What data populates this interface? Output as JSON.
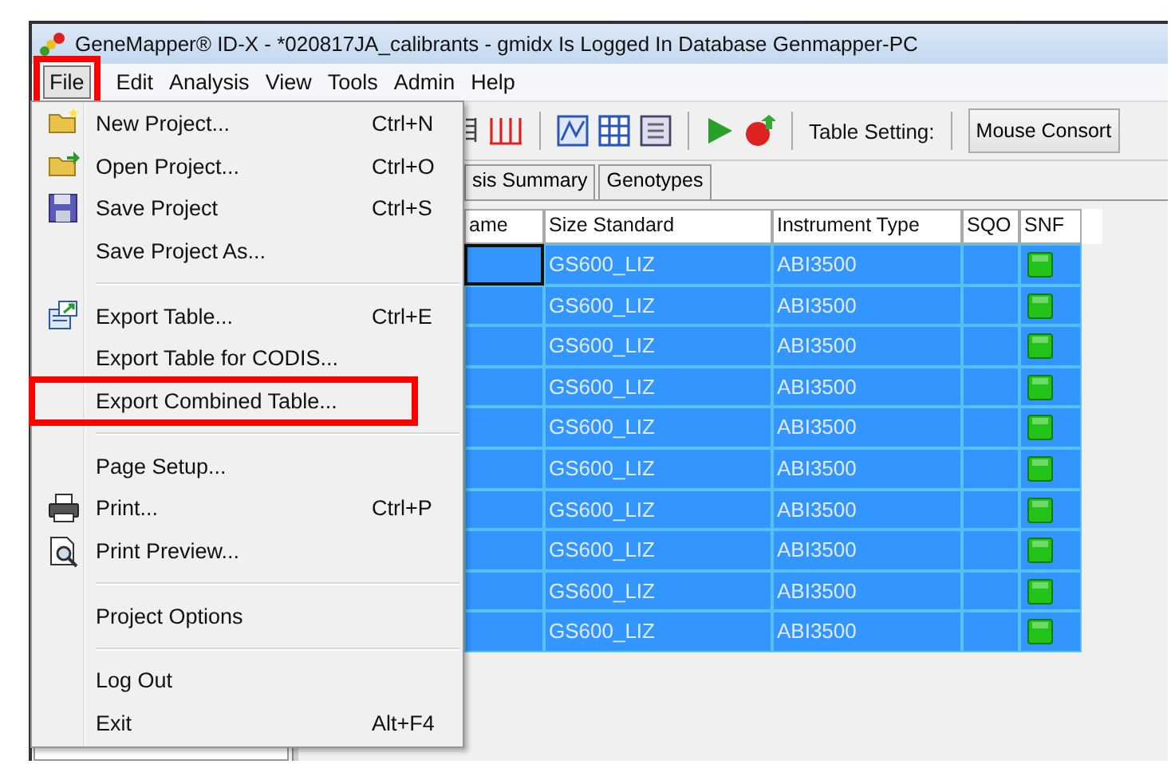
{
  "window": {
    "title": "GeneMapper® ID-X - *020817JA_calibrants - gmidx Is Logged In Database Genmapper-PC"
  },
  "menubar": [
    {
      "label": "File",
      "selected": true,
      "highlighted": true
    },
    {
      "label": "Edit",
      "selected": false,
      "highlighted": false
    },
    {
      "label": "Analysis",
      "selected": false,
      "highlighted": false
    },
    {
      "label": "View",
      "selected": false,
      "highlighted": false
    },
    {
      "label": "Tools",
      "selected": false,
      "highlighted": false
    },
    {
      "label": "Admin",
      "selected": false,
      "highlighted": false
    },
    {
      "label": "Help",
      "selected": false,
      "highlighted": false
    }
  ],
  "file_menu": [
    {
      "kind": "item",
      "label": "New Project...",
      "shortcut": "Ctrl+N",
      "highlighted": false
    },
    {
      "kind": "item",
      "label": "Open Project...",
      "shortcut": "Ctrl+O",
      "highlighted": false
    },
    {
      "kind": "item",
      "label": "Save Project",
      "shortcut": "Ctrl+S",
      "highlighted": false
    },
    {
      "kind": "item",
      "label": "Save Project As...",
      "highlighted": false
    },
    {
      "kind": "separator"
    },
    {
      "kind": "item",
      "label": "Export Table...",
      "shortcut": "Ctrl+E",
      "highlighted": false
    },
    {
      "kind": "item",
      "label": "Export Table for CODIS...",
      "highlighted": false
    },
    {
      "kind": "item",
      "label": "Export Combined Table...",
      "highlighted": true
    },
    {
      "kind": "separator"
    },
    {
      "kind": "item",
      "label": "Page Setup...",
      "highlighted": false
    },
    {
      "kind": "item",
      "label": "Print...",
      "shortcut": "Ctrl+P",
      "highlighted": false
    },
    {
      "kind": "item",
      "label": "Print Preview...",
      "highlighted": false
    },
    {
      "kind": "separator"
    },
    {
      "kind": "item",
      "label": "Project Options",
      "highlighted": false
    },
    {
      "kind": "separator"
    },
    {
      "kind": "item",
      "label": "Log Out",
      "highlighted": false
    },
    {
      "kind": "item",
      "label": "Exit",
      "shortcut": "Alt+F4",
      "highlighted": false
    }
  ],
  "toolbar": {
    "table_setting_label": "Table Setting:",
    "table_setting_value": "Mouse Consort"
  },
  "tabs": [
    {
      "label": "sis Summary",
      "selected": false
    },
    {
      "label": "Genotypes",
      "selected": false
    }
  ],
  "table": {
    "columns": [
      "ame",
      "Size Standard",
      "Instrument Type",
      "SQO",
      "SNF"
    ],
    "rows": [
      {
        "selected": true,
        "focused": true,
        "size_standard": "GS600_LIZ",
        "instrument_type": "ABI3500",
        "snf_passed": true
      },
      {
        "selected": true,
        "focused": false,
        "size_standard": "GS600_LIZ",
        "instrument_type": "ABI3500",
        "snf_passed": true
      },
      {
        "selected": true,
        "focused": false,
        "size_standard": "GS600_LIZ",
        "instrument_type": "ABI3500",
        "snf_passed": true
      },
      {
        "selected": true,
        "focused": false,
        "size_standard": "GS600_LIZ",
        "instrument_type": "ABI3500",
        "snf_passed": true
      },
      {
        "selected": true,
        "focused": false,
        "size_standard": "GS600_LIZ",
        "instrument_type": "ABI3500",
        "snf_passed": true
      },
      {
        "selected": true,
        "focused": false,
        "size_standard": "GS600_LIZ",
        "instrument_type": "ABI3500",
        "snf_passed": true
      },
      {
        "selected": true,
        "focused": false,
        "size_standard": "GS600_LIZ",
        "instrument_type": "ABI3500",
        "snf_passed": true
      },
      {
        "selected": true,
        "focused": false,
        "size_standard": "GS600_LIZ",
        "instrument_type": "ABI3500",
        "snf_passed": true
      },
      {
        "selected": true,
        "focused": false,
        "size_standard": "GS600_LIZ",
        "instrument_type": "ABI3500",
        "snf_passed": true
      },
      {
        "selected": true,
        "focused": false,
        "size_standard": "GS600_LIZ",
        "instrument_type": "ABI3500",
        "snf_passed": true
      }
    ]
  }
}
